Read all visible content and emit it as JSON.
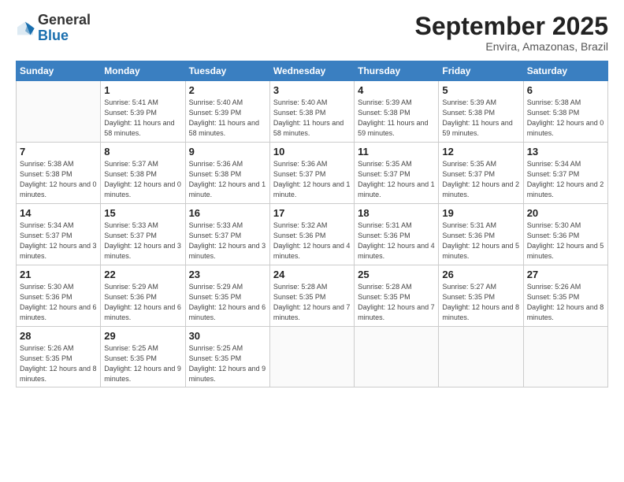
{
  "logo": {
    "general": "General",
    "blue": "Blue"
  },
  "header": {
    "month": "September 2025",
    "location": "Envira, Amazonas, Brazil"
  },
  "weekdays": [
    "Sunday",
    "Monday",
    "Tuesday",
    "Wednesday",
    "Thursday",
    "Friday",
    "Saturday"
  ],
  "weeks": [
    [
      {
        "day": "",
        "sunrise": "",
        "sunset": "",
        "daylight": ""
      },
      {
        "day": "1",
        "sunrise": "Sunrise: 5:41 AM",
        "sunset": "Sunset: 5:39 PM",
        "daylight": "Daylight: 11 hours and 58 minutes."
      },
      {
        "day": "2",
        "sunrise": "Sunrise: 5:40 AM",
        "sunset": "Sunset: 5:39 PM",
        "daylight": "Daylight: 11 hours and 58 minutes."
      },
      {
        "day": "3",
        "sunrise": "Sunrise: 5:40 AM",
        "sunset": "Sunset: 5:38 PM",
        "daylight": "Daylight: 11 hours and 58 minutes."
      },
      {
        "day": "4",
        "sunrise": "Sunrise: 5:39 AM",
        "sunset": "Sunset: 5:38 PM",
        "daylight": "Daylight: 11 hours and 59 minutes."
      },
      {
        "day": "5",
        "sunrise": "Sunrise: 5:39 AM",
        "sunset": "Sunset: 5:38 PM",
        "daylight": "Daylight: 11 hours and 59 minutes."
      },
      {
        "day": "6",
        "sunrise": "Sunrise: 5:38 AM",
        "sunset": "Sunset: 5:38 PM",
        "daylight": "Daylight: 12 hours and 0 minutes."
      }
    ],
    [
      {
        "day": "7",
        "sunrise": "Sunrise: 5:38 AM",
        "sunset": "Sunset: 5:38 PM",
        "daylight": "Daylight: 12 hours and 0 minutes."
      },
      {
        "day": "8",
        "sunrise": "Sunrise: 5:37 AM",
        "sunset": "Sunset: 5:38 PM",
        "daylight": "Daylight: 12 hours and 0 minutes."
      },
      {
        "day": "9",
        "sunrise": "Sunrise: 5:36 AM",
        "sunset": "Sunset: 5:38 PM",
        "daylight": "Daylight: 12 hours and 1 minute."
      },
      {
        "day": "10",
        "sunrise": "Sunrise: 5:36 AM",
        "sunset": "Sunset: 5:37 PM",
        "daylight": "Daylight: 12 hours and 1 minute."
      },
      {
        "day": "11",
        "sunrise": "Sunrise: 5:35 AM",
        "sunset": "Sunset: 5:37 PM",
        "daylight": "Daylight: 12 hours and 1 minute."
      },
      {
        "day": "12",
        "sunrise": "Sunrise: 5:35 AM",
        "sunset": "Sunset: 5:37 PM",
        "daylight": "Daylight: 12 hours and 2 minutes."
      },
      {
        "day": "13",
        "sunrise": "Sunrise: 5:34 AM",
        "sunset": "Sunset: 5:37 PM",
        "daylight": "Daylight: 12 hours and 2 minutes."
      }
    ],
    [
      {
        "day": "14",
        "sunrise": "Sunrise: 5:34 AM",
        "sunset": "Sunset: 5:37 PM",
        "daylight": "Daylight: 12 hours and 3 minutes."
      },
      {
        "day": "15",
        "sunrise": "Sunrise: 5:33 AM",
        "sunset": "Sunset: 5:37 PM",
        "daylight": "Daylight: 12 hours and 3 minutes."
      },
      {
        "day": "16",
        "sunrise": "Sunrise: 5:33 AM",
        "sunset": "Sunset: 5:37 PM",
        "daylight": "Daylight: 12 hours and 3 minutes."
      },
      {
        "day": "17",
        "sunrise": "Sunrise: 5:32 AM",
        "sunset": "Sunset: 5:36 PM",
        "daylight": "Daylight: 12 hours and 4 minutes."
      },
      {
        "day": "18",
        "sunrise": "Sunrise: 5:31 AM",
        "sunset": "Sunset: 5:36 PM",
        "daylight": "Daylight: 12 hours and 4 minutes."
      },
      {
        "day": "19",
        "sunrise": "Sunrise: 5:31 AM",
        "sunset": "Sunset: 5:36 PM",
        "daylight": "Daylight: 12 hours and 5 minutes."
      },
      {
        "day": "20",
        "sunrise": "Sunrise: 5:30 AM",
        "sunset": "Sunset: 5:36 PM",
        "daylight": "Daylight: 12 hours and 5 minutes."
      }
    ],
    [
      {
        "day": "21",
        "sunrise": "Sunrise: 5:30 AM",
        "sunset": "Sunset: 5:36 PM",
        "daylight": "Daylight: 12 hours and 6 minutes."
      },
      {
        "day": "22",
        "sunrise": "Sunrise: 5:29 AM",
        "sunset": "Sunset: 5:36 PM",
        "daylight": "Daylight: 12 hours and 6 minutes."
      },
      {
        "day": "23",
        "sunrise": "Sunrise: 5:29 AM",
        "sunset": "Sunset: 5:35 PM",
        "daylight": "Daylight: 12 hours and 6 minutes."
      },
      {
        "day": "24",
        "sunrise": "Sunrise: 5:28 AM",
        "sunset": "Sunset: 5:35 PM",
        "daylight": "Daylight: 12 hours and 7 minutes."
      },
      {
        "day": "25",
        "sunrise": "Sunrise: 5:28 AM",
        "sunset": "Sunset: 5:35 PM",
        "daylight": "Daylight: 12 hours and 7 minutes."
      },
      {
        "day": "26",
        "sunrise": "Sunrise: 5:27 AM",
        "sunset": "Sunset: 5:35 PM",
        "daylight": "Daylight: 12 hours and 8 minutes."
      },
      {
        "day": "27",
        "sunrise": "Sunrise: 5:26 AM",
        "sunset": "Sunset: 5:35 PM",
        "daylight": "Daylight: 12 hours and 8 minutes."
      }
    ],
    [
      {
        "day": "28",
        "sunrise": "Sunrise: 5:26 AM",
        "sunset": "Sunset: 5:35 PM",
        "daylight": "Daylight: 12 hours and 8 minutes."
      },
      {
        "day": "29",
        "sunrise": "Sunrise: 5:25 AM",
        "sunset": "Sunset: 5:35 PM",
        "daylight": "Daylight: 12 hours and 9 minutes."
      },
      {
        "day": "30",
        "sunrise": "Sunrise: 5:25 AM",
        "sunset": "Sunset: 5:35 PM",
        "daylight": "Daylight: 12 hours and 9 minutes."
      },
      {
        "day": "",
        "sunrise": "",
        "sunset": "",
        "daylight": ""
      },
      {
        "day": "",
        "sunrise": "",
        "sunset": "",
        "daylight": ""
      },
      {
        "day": "",
        "sunrise": "",
        "sunset": "",
        "daylight": ""
      },
      {
        "day": "",
        "sunrise": "",
        "sunset": "",
        "daylight": ""
      }
    ]
  ]
}
